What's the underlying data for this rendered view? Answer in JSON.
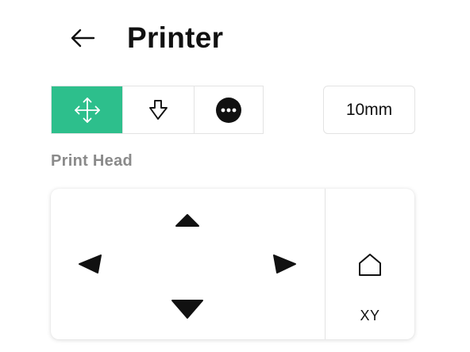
{
  "header": {
    "title": "Printer",
    "back_icon": "arrow-left-icon"
  },
  "modes": [
    {
      "name": "move",
      "icon": "move-arrows-icon",
      "active": true
    },
    {
      "name": "extrude",
      "icon": "arrow-down-outline-icon",
      "active": false
    },
    {
      "name": "more",
      "icon": "more-dots-icon",
      "active": false
    }
  ],
  "step": {
    "label": "10mm"
  },
  "print_head": {
    "label": "Print Head",
    "home_label": "XY",
    "home_icon": "home-icon"
  },
  "colors": {
    "accent": "#2dbf8c",
    "label_gray": "#8a8a8a",
    "border": "#e3e3e3"
  }
}
